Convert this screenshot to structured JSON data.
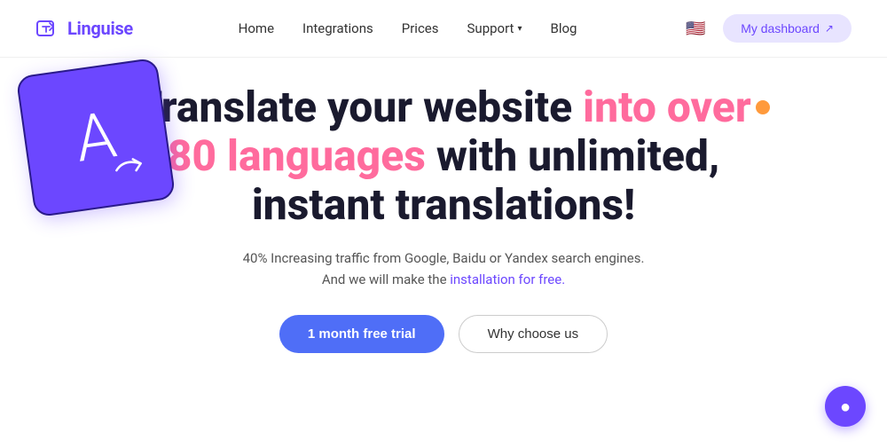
{
  "logo": {
    "text": "Linguise"
  },
  "nav": {
    "links": [
      {
        "label": "Home",
        "id": "home"
      },
      {
        "label": "Integrations",
        "id": "integrations"
      },
      {
        "label": "Prices",
        "id": "prices"
      },
      {
        "label": "Support",
        "id": "support",
        "hasDropdown": true
      },
      {
        "label": "Blog",
        "id": "blog"
      }
    ],
    "dashboard_btn": "My dashboard",
    "flag_emoji": "🇺🇸"
  },
  "hero": {
    "title_part1": "Translate your website ",
    "title_highlight": "into over 80 languages",
    "title_part2": " with unlimited, instant translations!",
    "subtitle_line1": "40% Increasing traffic from Google, Baidu or Yandex search engines.",
    "subtitle_line2": "And we will make the ",
    "subtitle_link": "installation for free.",
    "btn_primary": "1 month free trial",
    "btn_secondary": "Why choose us"
  },
  "chat": {
    "icon": "💬"
  }
}
